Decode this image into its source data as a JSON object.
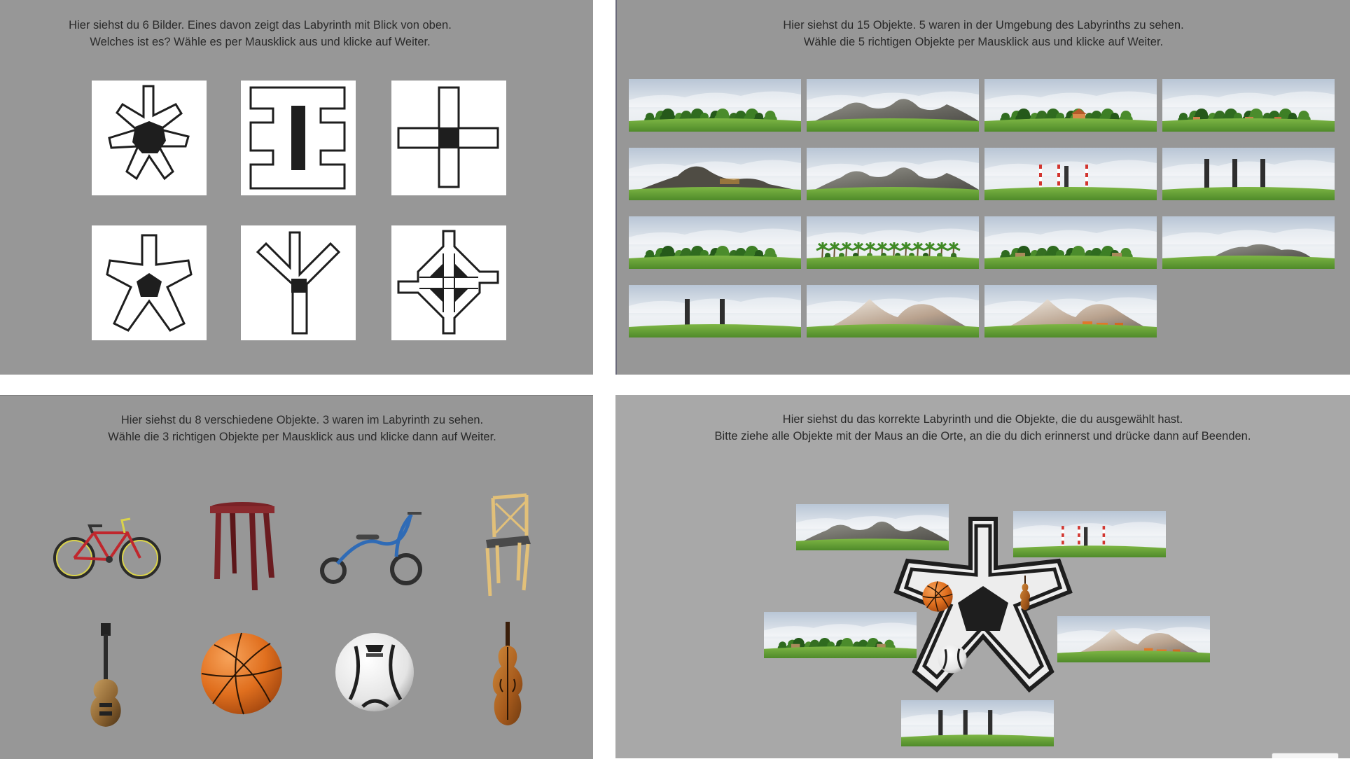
{
  "panel_maze": {
    "line1": "Hier siehst du 6 Bilder. Eines davon zeigt das Labyrinth mit Blick von oben.",
    "line2": "Welches ist es? Wähle es per Mausklick aus und klicke auf Weiter.",
    "options": [
      "maze-6-arms",
      "maze-h-shape",
      "maze-cross",
      "maze-5-arms",
      "maze-y-fork",
      "maze-diamond-cross"
    ]
  },
  "panel_landmarks": {
    "line1": "Hier siehst du 15 Objekte. 5 waren in der Umgebung des Labyrinths zu sehen.",
    "line2": "Wähle die 5 richtigen Objekte per Mausklick aus und klicke auf Weiter.",
    "scenes": [
      "bushes",
      "rock-hills",
      "trees-with-house",
      "trees-with-huts",
      "dark-mountain",
      "grey-hills",
      "red-white-chimneys",
      "three-dark-towers",
      "leafy-trees",
      "palm-trees",
      "trees-with-cabins",
      "rock-mound",
      "two-dark-towers",
      "snowy-peaks",
      "snowy-range-with-houses"
    ]
  },
  "panel_objects": {
    "line1": "Hier siehst du 8 verschiedene Objekte. 3 waren im Labyrinth zu sehen.",
    "line2": "Wähle die 3 richtigen Objekte per Mausklick aus und klicke dann auf Weiter.",
    "items": [
      "bicycle",
      "stool",
      "tricycle",
      "chair",
      "guitar",
      "basketball",
      "soccer-ball",
      "violin"
    ]
  },
  "panel_placement": {
    "line1": "Hier siehst du das korrekte Labyrinth und die Objekte, die du ausgewählt hast.",
    "line2": "Bitte ziehe alle Objekte mit der Maus an die Orte, an die du dich erinnerst und drücke dann auf Beenden."
  },
  "colors": {
    "panel_gray": "#979797",
    "panel_light": "#a8a8a8",
    "maze_stroke": "#1e1e1e",
    "grass": "#6fa83a",
    "sky": "#dfe6ee"
  }
}
